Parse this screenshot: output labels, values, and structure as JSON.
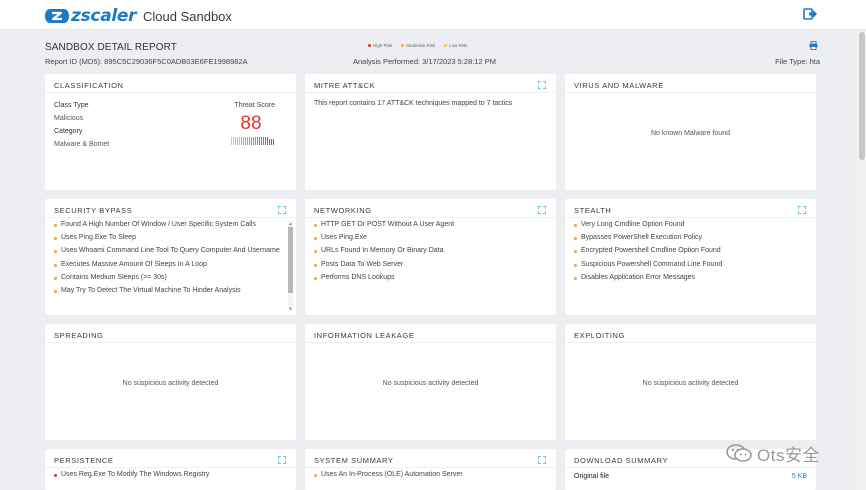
{
  "header": {
    "brand": "zscaler",
    "app_name": "Cloud Sandbox"
  },
  "report": {
    "title": "SANDBOX DETAIL REPORT",
    "id_text": "Report ID (MD5): 895C5C29036F5C0ADB03E6FE1998982A",
    "analysis_text": "Analysis Performed: 3/17/2023 5:28:12 PM",
    "filetype_text": "File Type: hta",
    "legend": [
      {
        "label": "High Risk",
        "color": "#e2332f"
      },
      {
        "label": "Moderate Risk",
        "color": "#f2a93b"
      },
      {
        "label": "Low Risk",
        "color": "#f2d23b"
      }
    ]
  },
  "classification": {
    "title": "CLASSIFICATION",
    "class_type_label": "Class Type",
    "class_type_value": "Malicious",
    "category_label": "Category",
    "category_value": "Malware & Botnet",
    "threat_score_label": "Threat Score",
    "threat_score": "88",
    "threat_level": 0.88
  },
  "mitre": {
    "title": "MITRE ATT&CK",
    "summary": "This report contains 17 ATT&CK techniques mapped to 7 tactics"
  },
  "virus": {
    "title": "VIRUS AND MALWARE",
    "message": "No known Malware found"
  },
  "security_bypass": {
    "title": "SECURITY BYPASS",
    "items": [
      {
        "text": "Found A High Number Of Window / User Specific System Calls",
        "risk": "moderate"
      },
      {
        "text": "Uses Ping.Exe To Sleep",
        "risk": "moderate"
      },
      {
        "text": "Uses Whoami Command Line Tool To Query Computer And Username",
        "risk": "moderate"
      },
      {
        "text": "Executes Massive Amount Of Sleeps In A Loop",
        "risk": "moderate"
      },
      {
        "text": "Contains Medium Sleeps (>= 30s)",
        "risk": "moderate"
      },
      {
        "text": "May Try To Detect The Virtual Machine To Hinder Analysis",
        "risk": "moderate"
      }
    ]
  },
  "networking": {
    "title": "NETWORKING",
    "items": [
      {
        "text": "HTTP GET Or POST Without A User Agent",
        "risk": "moderate"
      },
      {
        "text": "Uses Ping.Exe",
        "risk": "moderate"
      },
      {
        "text": "URLs Found In Memory Or Binary Data",
        "risk": "moderate"
      },
      {
        "text": "Posts Data To Web Server",
        "risk": "moderate"
      },
      {
        "text": "Performs DNS Lookups",
        "risk": "moderate"
      }
    ]
  },
  "stealth": {
    "title": "STEALTH",
    "items": [
      {
        "text": "Very Long Cmdline Option Found",
        "risk": "moderate"
      },
      {
        "text": "Bypasses PowerShell Execution Policy",
        "risk": "moderate"
      },
      {
        "text": "Encrypted Powershell Cmdline Option Found",
        "risk": "moderate"
      },
      {
        "text": "Suspicious Powershell Command Line Found",
        "risk": "moderate"
      },
      {
        "text": "Disables Application Error Messages",
        "risk": "moderate"
      }
    ]
  },
  "spreading": {
    "title": "SPREADING",
    "message": "No suspicious activity detected"
  },
  "info_leakage": {
    "title": "INFORMATION LEAKAGE",
    "message": "No suspicious activity detected"
  },
  "exploiting": {
    "title": "EXPLOITING",
    "message": "No suspicious activity detected"
  },
  "persistence": {
    "title": "PERSISTENCE",
    "items": [
      {
        "text": "Uses Reg.Exe To Modify The Windows Registry",
        "risk": "high"
      }
    ]
  },
  "system_summary": {
    "title": "SYSTEM SUMMARY",
    "items": [
      {
        "text": "Uses An In-Process (OLE) Automation Server",
        "risk": "moderate"
      }
    ]
  },
  "download": {
    "title": "DOWNLOAD SUMMARY",
    "original_label": "Original file",
    "original_value": "5 KB"
  },
  "watermark": {
    "text": "Ots安全"
  },
  "colors": {
    "brand": "#1f7ac6",
    "high": "#e2332f",
    "moderate": "#f2a93b",
    "low": "#f2d23b"
  },
  "icons": [
    "zscaler-logo-icon",
    "logout-icon",
    "print-icon",
    "expand-icon",
    "wechat-icon"
  ]
}
